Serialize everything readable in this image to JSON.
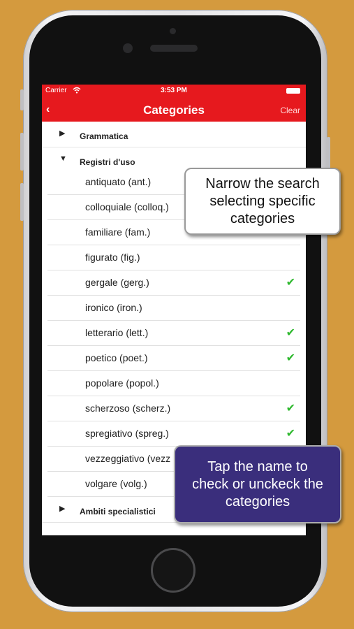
{
  "statusbar": {
    "carrier": "Carrier",
    "time": "3:53 PM"
  },
  "navbar": {
    "back_icon": "chevron-left-icon",
    "title": "Categories",
    "clear_label": "Clear"
  },
  "sections": [
    {
      "label": "Grammatica",
      "expanded": false
    },
    {
      "label": "Registri d'uso",
      "expanded": true
    },
    {
      "label": "Ambiti specialistici",
      "expanded": false
    }
  ],
  "items": [
    {
      "label": "antiquato (ant.)",
      "checked": false
    },
    {
      "label": "colloquiale (colloq.)",
      "checked": false
    },
    {
      "label": "familiare (fam.)",
      "checked": false
    },
    {
      "label": "figurato (fig.)",
      "checked": false
    },
    {
      "label": "gergale (gerg.)",
      "checked": true
    },
    {
      "label": "ironico (iron.)",
      "checked": false
    },
    {
      "label": "letterario (lett.)",
      "checked": true
    },
    {
      "label": "poetico (poet.)",
      "checked": true
    },
    {
      "label": "popolare (popol.)",
      "checked": false
    },
    {
      "label": "scherzoso (scherz.)",
      "checked": true
    },
    {
      "label": "spregiativo (spreg.)",
      "checked": true
    },
    {
      "label": "vezzeggiativo (vezz",
      "checked": false
    },
    {
      "label": "volgare (volg.)",
      "checked": false
    }
  ],
  "glyphs": {
    "collapsed": "▶",
    "expanded": "▼",
    "check": "✔",
    "back": "‹"
  },
  "callouts": {
    "top": [
      "Narrow the search",
      "selecting specific",
      "categories"
    ],
    "bottom": [
      "Tap the name to",
      "check or unckeck the",
      "categories"
    ]
  },
  "colors": {
    "accent": "#e6191e",
    "check": "#2db82d",
    "background": "#d49a3e",
    "callout_bottom": "#3a2e7c"
  }
}
